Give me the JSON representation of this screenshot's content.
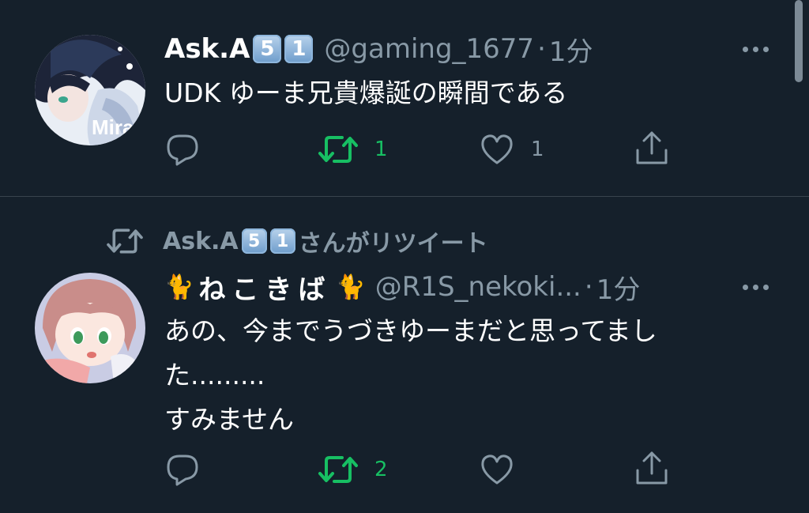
{
  "tweets": [
    {
      "display_name": "Ask.A",
      "badges": [
        "5",
        "1"
      ],
      "handle": "@gaming_1677",
      "separator": "·",
      "time": "1分",
      "text": "UDK ゆーま兄貴爆誕の瞬間である",
      "avatar_text": "Mira",
      "reply_count": "",
      "retweet_count": "1",
      "like_count": "1",
      "retweeted_by_me": true
    },
    {
      "retweet_context": {
        "name": "Ask.A",
        "badges": [
          "5",
          "1"
        ],
        "suffix": "さんがリツイート"
      },
      "display_name_emoji": "🐈",
      "display_name": "ねこきば",
      "handle": "@R1S_nekoki...",
      "separator": "·",
      "time": "1分",
      "text_lines": [
        "あの、今までうづきゆーまだと思ってまし",
        "た.........",
        "すみません"
      ],
      "reply_count": "",
      "retweet_count": "2",
      "like_count": "",
      "retweeted_by_me": true
    }
  ],
  "colors": {
    "background": "#15202b",
    "divider": "#38444d",
    "secondary_text": "#8899a6",
    "retweet_active": "#17bf63"
  },
  "icons": [
    "reply-icon",
    "retweet-icon",
    "like-icon",
    "share-icon",
    "more-icon"
  ]
}
